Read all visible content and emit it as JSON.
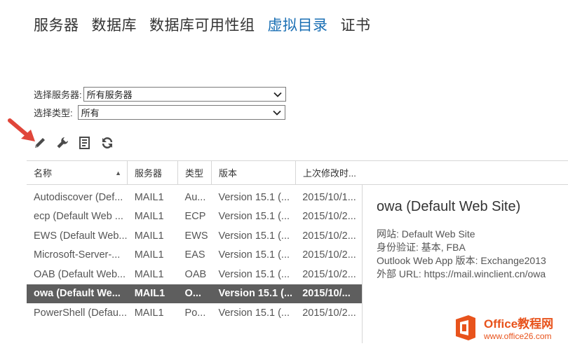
{
  "tabs": [
    {
      "label": "服务器"
    },
    {
      "label": "数据库"
    },
    {
      "label": "数据库可用性组"
    },
    {
      "label": "虚拟目录",
      "active": true
    },
    {
      "label": "证书"
    }
  ],
  "filters": {
    "server": {
      "label": "选择服务器:",
      "value": "所有服务器"
    },
    "type": {
      "label": "选择类型:",
      "value": "所有"
    }
  },
  "toolbar": [
    "edit-icon",
    "wrench-icon",
    "properties-icon",
    "refresh-icon"
  ],
  "table": {
    "columns": [
      "名称",
      "服务器",
      "类型",
      "版本",
      "上次修改时..."
    ],
    "rows": [
      {
        "name": "Autodiscover (Def...",
        "server": "MAIL1",
        "type": "Au...",
        "version": "Version 15.1 (...",
        "modified": "2015/10/1..."
      },
      {
        "name": "ecp (Default Web ...",
        "server": "MAIL1",
        "type": "ECP",
        "version": "Version 15.1 (...",
        "modified": "2015/10/2..."
      },
      {
        "name": "EWS (Default Web...",
        "server": "MAIL1",
        "type": "EWS",
        "version": "Version 15.1 (...",
        "modified": "2015/10/2..."
      },
      {
        "name": "Microsoft-Server-...",
        "server": "MAIL1",
        "type": "EAS",
        "version": "Version 15.1 (...",
        "modified": "2015/10/2..."
      },
      {
        "name": "OAB (Default Web...",
        "server": "MAIL1",
        "type": "OAB",
        "version": "Version 15.1 (...",
        "modified": "2015/10/2..."
      },
      {
        "name": "owa (Default We...",
        "server": "MAIL1",
        "type": "O...",
        "version": "Version 15.1 (...",
        "modified": "2015/10/...",
        "selected": true
      },
      {
        "name": "PowerShell (Defau...",
        "server": "MAIL1",
        "type": "Po...",
        "version": "Version 15.1 (...",
        "modified": "2015/10/2..."
      }
    ]
  },
  "detail": {
    "title": "owa (Default Web Site)",
    "lines": [
      "网站: Default Web Site",
      "身份验证: 基本, FBA",
      "Outlook Web App 版本: Exchange2013",
      "外部 URL: https://mail.winclient.cn/owa"
    ]
  },
  "watermark": {
    "main": "Office教程网",
    "sub": "www.office26.com"
  },
  "colors": {
    "active_tab": "#1a6fb4",
    "selected_row": "#5e5e5e",
    "arrow": "#e0463a",
    "logo": "#e8531c"
  }
}
